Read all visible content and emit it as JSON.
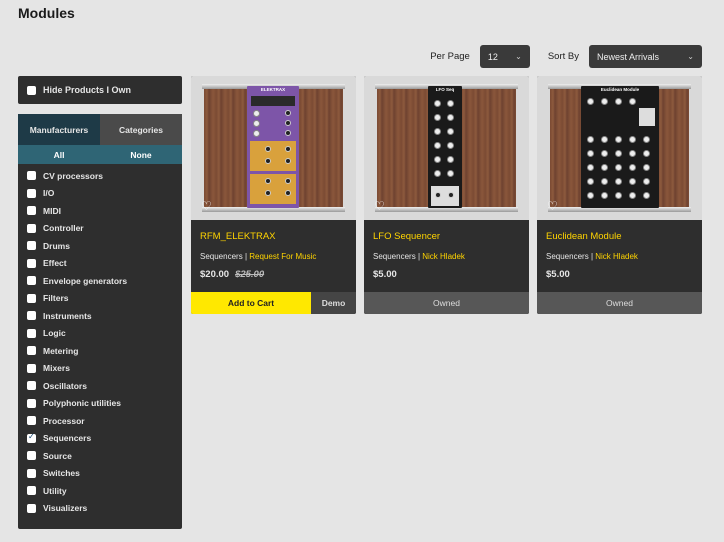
{
  "page": {
    "title": "Modules"
  },
  "controls": {
    "per_page_label": "Per Page",
    "per_page_value": "12",
    "sort_label": "Sort By",
    "sort_value": "Newest Arrivals"
  },
  "sidebar": {
    "hide_owned_label": "Hide Products I Own",
    "tabs": [
      {
        "label": "Manufacturers"
      },
      {
        "label": "Categories"
      }
    ],
    "subtabs": [
      {
        "label": "All"
      },
      {
        "label": "None"
      }
    ],
    "categories": [
      {
        "label": "CV processors",
        "checked": false
      },
      {
        "label": "I/O",
        "checked": false
      },
      {
        "label": "MIDI",
        "checked": false
      },
      {
        "label": "Controller",
        "checked": false
      },
      {
        "label": "Drums",
        "checked": false
      },
      {
        "label": "Effect",
        "checked": false
      },
      {
        "label": "Envelope generators",
        "checked": false
      },
      {
        "label": "Filters",
        "checked": false
      },
      {
        "label": "Instruments",
        "checked": false
      },
      {
        "label": "Logic",
        "checked": false
      },
      {
        "label": "Metering",
        "checked": false
      },
      {
        "label": "Mixers",
        "checked": false
      },
      {
        "label": "Oscillators",
        "checked": false
      },
      {
        "label": "Polyphonic utilities",
        "checked": false
      },
      {
        "label": "Processor",
        "checked": false
      },
      {
        "label": "Sequencers",
        "checked": true
      },
      {
        "label": "Source",
        "checked": false
      },
      {
        "label": "Switches",
        "checked": false
      },
      {
        "label": "Utility",
        "checked": false
      },
      {
        "label": "Visualizers",
        "checked": false
      }
    ]
  },
  "products": [
    {
      "title": "RFM_ELEKTRAX",
      "category": "Sequencers",
      "separator": "|",
      "brand": "Request For Music",
      "price": "$20.00",
      "old_price": "$25.00",
      "cart_label": "Add to Cart",
      "demo_label": "Demo",
      "module_label": "ELEKTRAX",
      "module_color": "#7d55a8",
      "owned": false
    },
    {
      "title": "LFO Sequencer",
      "category": "Sequencers",
      "separator": "|",
      "brand": "Nick Hladek",
      "price": "$5.00",
      "owned_label": "Owned",
      "module_label": "LFO Seq",
      "module_color": "#1a1a1a",
      "owned": true
    },
    {
      "title": "Euclidean Module",
      "category": "Sequencers",
      "separator": "|",
      "brand": "Nick Hladek",
      "price": "$5.00",
      "owned_label": "Owned",
      "module_label": "Euclidean Module",
      "module_color": "#1a1a1a",
      "owned": true
    }
  ],
  "icons": {
    "heart": "heart-icon",
    "chevron": "chevron-down-icon",
    "check": "checkmark-icon"
  },
  "colors": {
    "accent": "#ffe800",
    "brand_text": "#ffd400",
    "panel": "#2e2e2e",
    "tab_active": "#1e3a47",
    "subtab": "#2f6575"
  }
}
